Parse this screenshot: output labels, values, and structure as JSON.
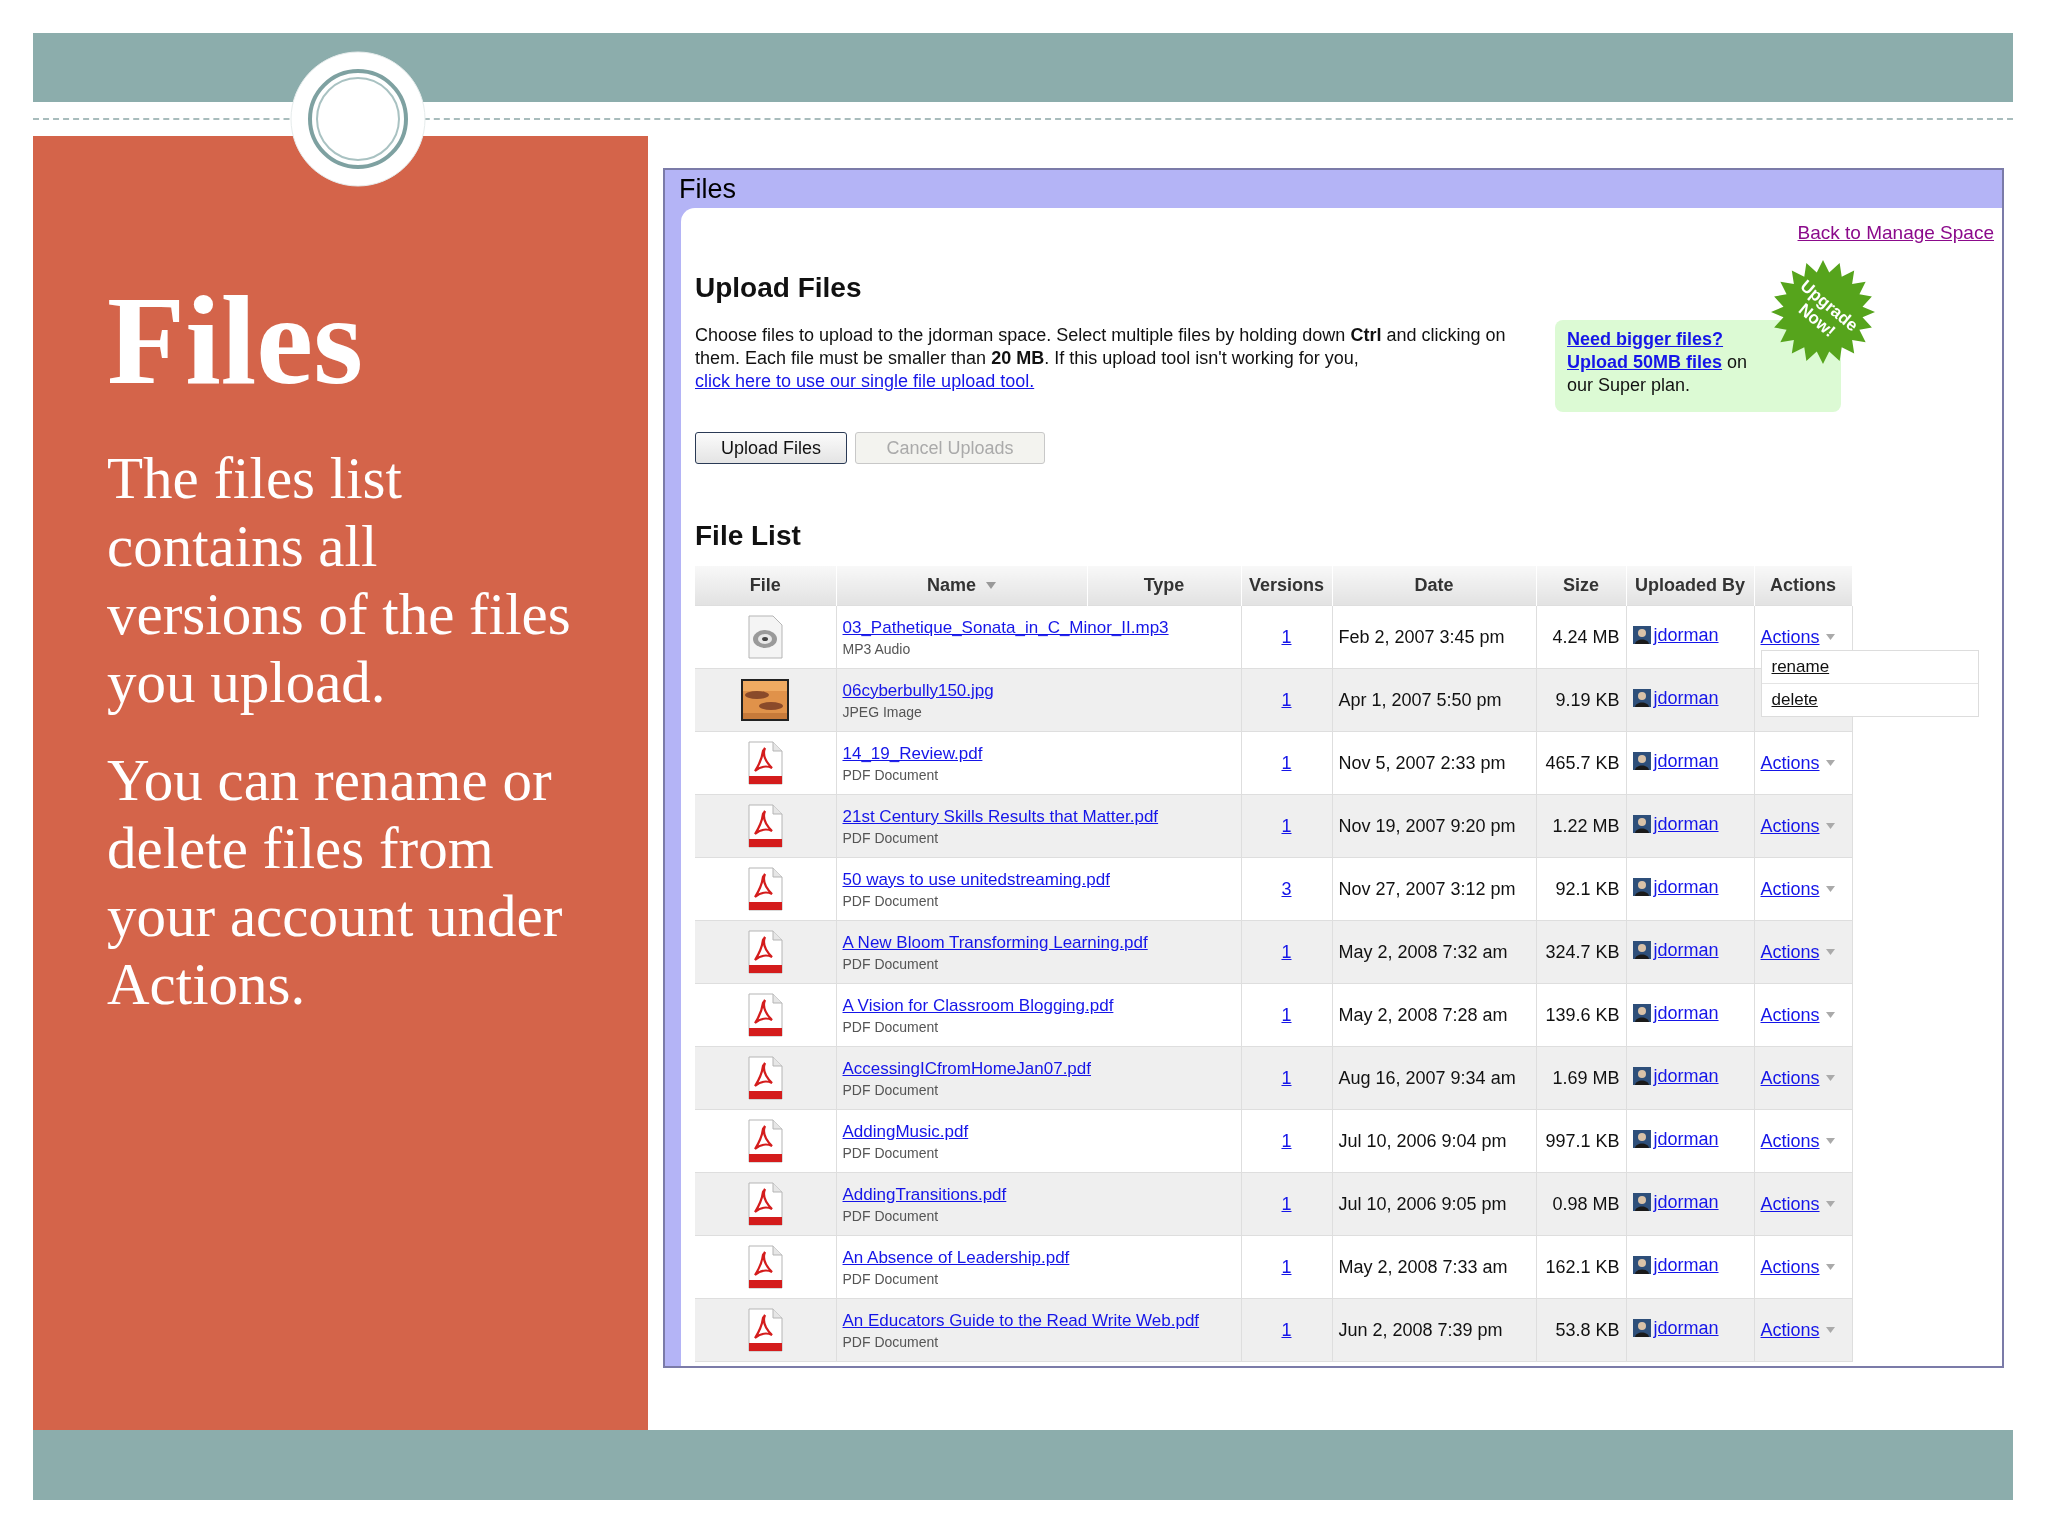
{
  "slide": {
    "title": "Files",
    "paragraphs": [
      "The files list contains all versions of the files you upload.",
      "You can rename or delete files from your account under Actions."
    ]
  },
  "window": {
    "title": "Files",
    "back_link": "Back to Manage Space"
  },
  "upload": {
    "heading": "Upload Files",
    "text": "Choose files to upload to the jdorman space. Select multiple files by holding down **Ctrl** and clicking on them. Each file must be smaller than **20 MB**. If this upload tool isn't working for you,",
    "link": "click here to use our single file upload tool.",
    "promo": {
      "link_1": "Need bigger files?",
      "link_2": "Upload 50MB files",
      "text": "on our Super plan.",
      "badge": "Upgrade Now!"
    },
    "buttons": [
      {
        "label": "Upload Files",
        "disabled": false
      },
      {
        "label": "Cancel Uploads",
        "disabled": true
      }
    ]
  },
  "file_list": {
    "heading": "File List",
    "columns": [
      {
        "label": "File",
        "sorted": false
      },
      {
        "label": "Name",
        "sorted": true
      },
      {
        "label": "Type",
        "sorted": false
      },
      {
        "label": "Versions",
        "sorted": false
      },
      {
        "label": "Date",
        "sorted": false
      },
      {
        "label": "Size",
        "sorted": false
      },
      {
        "label": "Uploaded By",
        "sorted": false
      },
      {
        "label": "Actions",
        "sorted": false
      }
    ],
    "rows": [
      {
        "kind": "audio",
        "name": "03_Pathetique_Sonata_in_C_Minor_II.mp3",
        "type": "MP3 Audio",
        "versions": "1",
        "date": "Feb 2, 2007 3:45 pm",
        "size": "4.24 MB",
        "uploaded_by": "jdorman",
        "actions": "Actions",
        "menu_items": [
          "rename",
          "delete"
        ]
      },
      {
        "kind": "picture",
        "name": "06cyberbully150.jpg",
        "type": "JPEG Image",
        "versions": "1",
        "date": "Apr 1, 2007 5:50 pm",
        "size": "9.19 KB",
        "uploaded_by": "jdorman"
      },
      {
        "kind": "pdf",
        "name": "14_19_Review.pdf",
        "type": "PDF Document",
        "versions": "1",
        "date": "Nov 5, 2007 2:33 pm",
        "size": "465.7 KB",
        "uploaded_by": "jdorman",
        "actions": "Actions"
      },
      {
        "kind": "pdf",
        "name": "21st Century Skills Results that Matter.pdf",
        "type": "PDF Document",
        "versions": "1",
        "date": "Nov 19, 2007 9:20 pm",
        "size": "1.22 MB",
        "uploaded_by": "jdorman",
        "actions": "Actions"
      },
      {
        "kind": "pdf",
        "name": "50 ways to use unitedstreaming.pdf",
        "type": "PDF Document",
        "versions": "3",
        "date": "Nov 27, 2007 3:12 pm",
        "size": "92.1 KB",
        "uploaded_by": "jdorman",
        "actions": "Actions"
      },
      {
        "kind": "pdf",
        "name": "A New Bloom Transforming Learning.pdf",
        "type": "PDF Document",
        "versions": "1",
        "date": "May 2, 2008 7:32 am",
        "size": "324.7 KB",
        "uploaded_by": "jdorman",
        "actions": "Actions"
      },
      {
        "kind": "pdf",
        "name": "A Vision for Classroom Blogging.pdf",
        "type": "PDF Document",
        "versions": "1",
        "date": "May 2, 2008 7:28 am",
        "size": "139.6 KB",
        "uploaded_by": "jdorman",
        "actions": "Actions"
      },
      {
        "kind": "pdf",
        "name": "AccessingICfromHomeJan07.pdf",
        "type": "PDF Document",
        "versions": "1",
        "date": "Aug 16, 2007 9:34 am",
        "size": "1.69 MB",
        "uploaded_by": "jdorman",
        "actions": "Actions"
      },
      {
        "kind": "pdf",
        "name": "AddingMusic.pdf",
        "type": "PDF Document",
        "versions": "1",
        "date": "Jul 10, 2006 9:04 pm",
        "size": "997.1 KB",
        "uploaded_by": "jdorman",
        "actions": "Actions"
      },
      {
        "kind": "pdf",
        "name": "AddingTransitions.pdf",
        "type": "PDF Document",
        "versions": "1",
        "date": "Jul 10, 2006 9:05 pm",
        "size": "0.98 MB",
        "uploaded_by": "jdorman",
        "actions": "Actions"
      },
      {
        "kind": "pdf",
        "name": "An Absence of Leadership.pdf",
        "type": "PDF Document",
        "versions": "1",
        "date": "May 2, 2008 7:33 am",
        "size": "162.1 KB",
        "uploaded_by": "jdorman",
        "actions": "Actions"
      },
      {
        "kind": "pdf",
        "name": "An Educators Guide to the Read Write Web.pdf",
        "type": "PDF Document",
        "versions": "1",
        "date": "Jun 2, 2008 7:39 pm",
        "size": "53.8 KB",
        "uploaded_by": "jdorman",
        "actions": "Actions"
      }
    ]
  }
}
